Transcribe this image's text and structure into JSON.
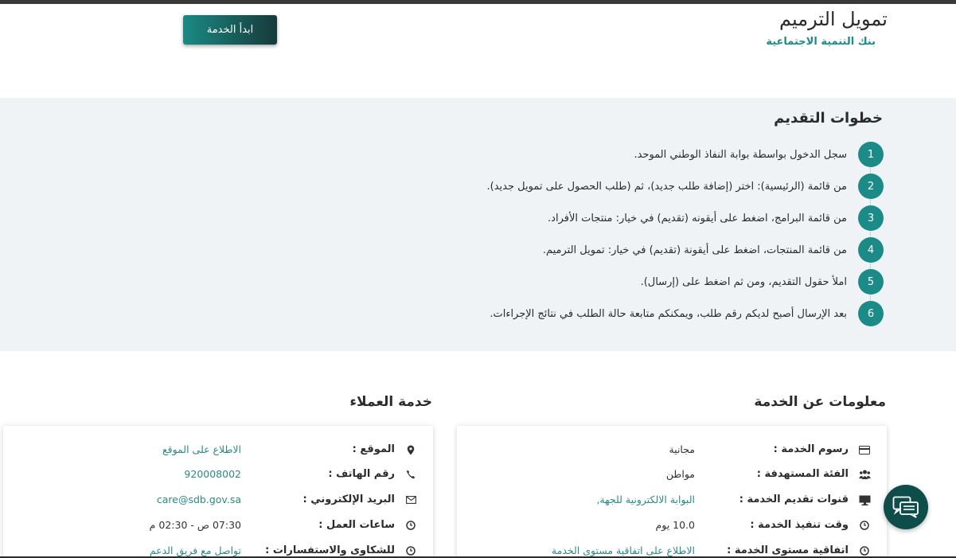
{
  "header": {
    "title": "تمويل الترميم",
    "subtitle": "بنك التنمية الاجتماعية",
    "start_button": "ابدأ الخدمة"
  },
  "steps": {
    "title": "خطوات التقديم",
    "items": [
      {
        "num": "1",
        "text": "سجل الدخول بواسطة بوابة النفاذ الوطني الموحد."
      },
      {
        "num": "2",
        "text": "من قائمة (الرئيسية): اختر (إضافة طلب جديد)، ثم (طلب الحصول على تمويل جديد)."
      },
      {
        "num": "3",
        "text": "من قائمة البرامج، اضغط على أيقونه (تقديم) في خيار: منتجات الأفراد."
      },
      {
        "num": "4",
        "text": "من قائمة المنتجات، اضغط على أيقونة (تقديم) في خيار: تمويل الترميم."
      },
      {
        "num": "5",
        "text": "املأ حقول التقديم، ومن ثم اضغط على (إرسال)."
      },
      {
        "num": "6",
        "text": "بعد الإرسال أصبح لديكم رقم طلب، ويمكنكم متابعة حالة الطلب في نتائج الإجراءات."
      }
    ]
  },
  "service_info": {
    "title": "معلومات عن الخدمة",
    "rows": [
      {
        "icon": "credit-card-icon",
        "label": "رسوم الخدمة :",
        "value": "مجانية",
        "link": false
      },
      {
        "icon": "users-icon",
        "label": "الفئة المستهدفة :",
        "value": "مواطن",
        "link": false
      },
      {
        "icon": "monitor-icon",
        "label": "قنوات تقديم الخدمة :",
        "value": "البوابة الالكترونية للجهة,",
        "link": true
      },
      {
        "icon": "clock-icon",
        "label": "وقت تنفيذ الخدمة :",
        "value": "10.0 يوم",
        "link": false
      },
      {
        "icon": "clock-icon",
        "label": "اتفاقية مستوى الخدمة :",
        "value": "الاطلاع على اتفاقية مستوى الخدمة",
        "link": true
      }
    ]
  },
  "customer_service": {
    "title": "خدمة العملاء",
    "rows": [
      {
        "icon": "location-pin-icon",
        "label": "الموقع :",
        "value": "الاطلاع على الموقع",
        "link": true
      },
      {
        "icon": "phone-icon",
        "label": "رقم الهاتف :",
        "value": "920008002",
        "link": true
      },
      {
        "icon": "envelope-icon",
        "label": "البريد الإلكتروني :",
        "value": "care@sdb.gov.sa",
        "link": true
      },
      {
        "icon": "clock-icon",
        "label": "ساعات العمل :",
        "value": "07:30 ص - 02:30 م",
        "link": false
      },
      {
        "icon": "clock-icon",
        "label": "للشكاوى والاستفسارات :",
        "value": "تواصل مع فريق الدعم",
        "link": true
      }
    ]
  },
  "chat": {
    "icon": "chat-bubbles-icon"
  },
  "colors": {
    "accent": "#1c8a86",
    "band": "#eff3f6",
    "chat": "#0f4d4b"
  }
}
